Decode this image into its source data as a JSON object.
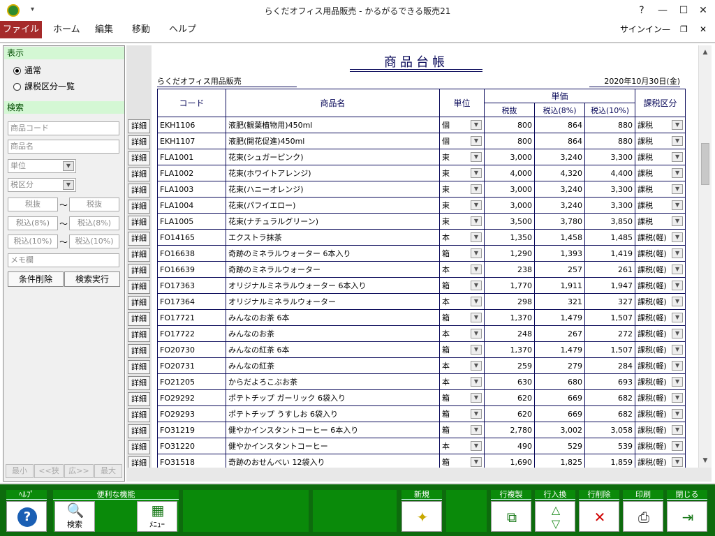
{
  "window": {
    "title": "らくだオフィス用品販売 - かるがるできる販売21",
    "help": "?",
    "minimize": "—",
    "maximize": "☐",
    "close": "✕"
  },
  "menubar": {
    "items": [
      "ファイル",
      "ホーム",
      "編集",
      "移動",
      "ヘルプ"
    ],
    "signin": "サインイン"
  },
  "left": {
    "display_header": "表示",
    "radio_normal": "通常",
    "radio_taxlist": "課税区分一覧",
    "search_header": "検索",
    "product_code": "商品コード",
    "product_name": "商品名",
    "unit": "単位",
    "tax_class": "税区分",
    "tax_excl": "税抜",
    "tax_incl8": "税込(8%)",
    "tax_incl10": "税込(10%)",
    "tilde": "～",
    "memo": "メモ欄",
    "clear": "条件削除",
    "execute": "検索実行",
    "nav": [
      "最小",
      "<<狭",
      "広>>",
      "最大"
    ]
  },
  "detail_label": "詳細",
  "report": {
    "title": "商品台帳",
    "company": "らくだオフィス用品販売",
    "date": "2020年10月30日(金)",
    "headers": {
      "code": "コード",
      "name": "商品名",
      "unit": "単位",
      "price": "単価",
      "excl": "税抜",
      "incl8": "税込(8%)",
      "incl10": "税込(10%)",
      "tax": "課税区分"
    },
    "rows": [
      [
        "EKH1106",
        "液肥(観葉植物用)450ml",
        "個",
        "800",
        "864",
        "880",
        "課税"
      ],
      [
        "EKH1107",
        "液肥(開花促進)450ml",
        "個",
        "800",
        "864",
        "880",
        "課税"
      ],
      [
        "FLA1001",
        "花束(シュガーピンク)",
        "束",
        "3,000",
        "3,240",
        "3,300",
        "課税"
      ],
      [
        "FLA1002",
        "花束(ホワイトアレンジ)",
        "束",
        "4,000",
        "4,320",
        "4,400",
        "課税"
      ],
      [
        "FLA1003",
        "花束(ハニーオレンジ)",
        "束",
        "3,000",
        "3,240",
        "3,300",
        "課税"
      ],
      [
        "FLA1004",
        "花束(パフイエロー)",
        "束",
        "3,000",
        "3,240",
        "3,300",
        "課税"
      ],
      [
        "FLA1005",
        "花束(ナチュラルグリーン)",
        "束",
        "3,500",
        "3,780",
        "3,850",
        "課税"
      ],
      [
        "FO14165",
        "エクストラ抹茶",
        "本",
        "1,350",
        "1,458",
        "1,485",
        "課税(軽)"
      ],
      [
        "FO16638",
        "奇跡のミネラルウォーター 6本入り",
        "箱",
        "1,290",
        "1,393",
        "1,419",
        "課税(軽)"
      ],
      [
        "FO16639",
        "奇跡のミネラルウォーター",
        "本",
        "238",
        "257",
        "261",
        "課税(軽)"
      ],
      [
        "FO17363",
        "オリジナルミネラルウォーター 6本入り",
        "箱",
        "1,770",
        "1,911",
        "1,947",
        "課税(軽)"
      ],
      [
        "FO17364",
        "オリジナルミネラルウォーター",
        "本",
        "298",
        "321",
        "327",
        "課税(軽)"
      ],
      [
        "FO17721",
        "みんなのお茶 6本",
        "箱",
        "1,370",
        "1,479",
        "1,507",
        "課税(軽)"
      ],
      [
        "FO17722",
        "みんなのお茶",
        "本",
        "248",
        "267",
        "272",
        "課税(軽)"
      ],
      [
        "FO20730",
        "みんなの紅茶 6本",
        "箱",
        "1,370",
        "1,479",
        "1,507",
        "課税(軽)"
      ],
      [
        "FO20731",
        "みんなの紅茶",
        "本",
        "259",
        "279",
        "284",
        "課税(軽)"
      ],
      [
        "FO21205",
        "からだよろこぶお茶",
        "本",
        "630",
        "680",
        "693",
        "課税(軽)"
      ],
      [
        "FO29292",
        "ポテトチップ ガーリック 6袋入り",
        "箱",
        "620",
        "669",
        "682",
        "課税(軽)"
      ],
      [
        "FO29293",
        "ポテトチップ うすしお 6袋入り",
        "箱",
        "620",
        "669",
        "682",
        "課税(軽)"
      ],
      [
        "FO31219",
        "健やかインスタントコーヒー 6本入り",
        "箱",
        "2,780",
        "3,002",
        "3,058",
        "課税(軽)"
      ],
      [
        "FO31220",
        "健やかインスタントコーヒー",
        "本",
        "490",
        "529",
        "539",
        "課税(軽)"
      ],
      [
        "FO31518",
        "奇跡のおせんべい 12袋入り",
        "箱",
        "1,690",
        "1,825",
        "1,859",
        "課税(軽)"
      ]
    ]
  },
  "toolbar": {
    "help": "ﾍﾙﾌﾟ",
    "convenience": "便利な機能",
    "search": "検索",
    "menu": "ﾒﾆｭｰ",
    "new": "新規",
    "copy_row": "行複製",
    "swap_row": "行入換",
    "delete_row": "行削除",
    "print": "印刷",
    "close": "閉じる"
  }
}
